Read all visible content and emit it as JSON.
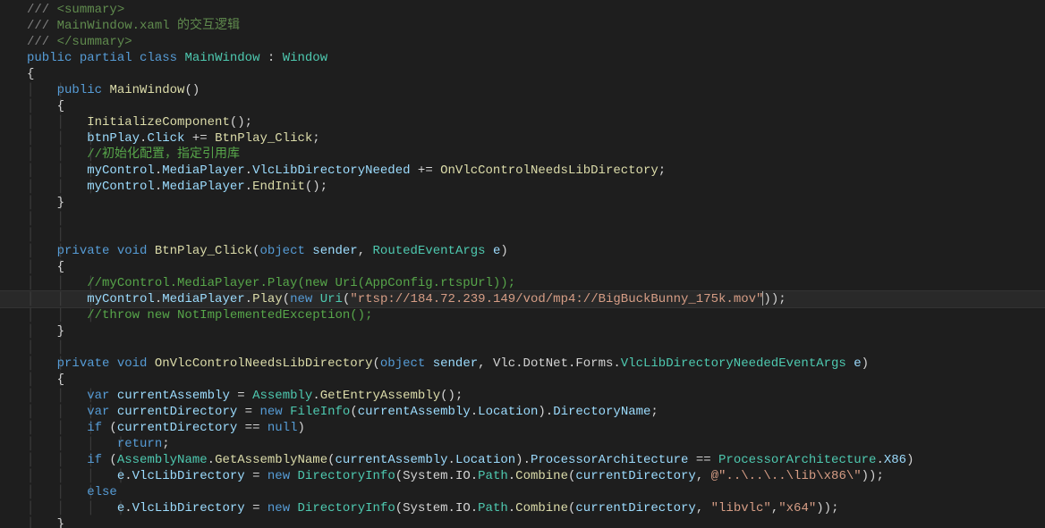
{
  "colors": {
    "background": "#1e1e1e",
    "comment": "#57a64a",
    "keyword": "#569cd6",
    "type": "#4ec9b0",
    "method": "#dcdcaa",
    "variable": "#9cdcfe",
    "string": "#d69d85",
    "default": "#d4d4d4",
    "gray": "#808080"
  },
  "code": {
    "lines": [
      {
        "indent": 0,
        "tokens": [
          [
            "c-gray",
            "///"
          ],
          [
            "c-xmlcomment",
            " <summary>"
          ]
        ]
      },
      {
        "indent": 0,
        "tokens": [
          [
            "c-gray",
            "///"
          ],
          [
            "c-xmlcomment",
            " MainWindow.xaml 的交互逻辑"
          ]
        ]
      },
      {
        "indent": 0,
        "tokens": [
          [
            "c-gray",
            "///"
          ],
          [
            "c-xmlcomment",
            " </summary>"
          ]
        ]
      },
      {
        "indent": 0,
        "tokens": [
          [
            "c-keyword",
            "public"
          ],
          [
            "c-punct",
            " "
          ],
          [
            "c-keyword",
            "partial"
          ],
          [
            "c-punct",
            " "
          ],
          [
            "c-keyword",
            "class"
          ],
          [
            "c-punct",
            " "
          ],
          [
            "c-type",
            "MainWindow"
          ],
          [
            "c-punct",
            " : "
          ],
          [
            "c-type",
            "Window"
          ]
        ]
      },
      {
        "indent": 0,
        "tokens": [
          [
            "c-punct",
            "{"
          ]
        ]
      },
      {
        "indent": 1,
        "tokens": [
          [
            "c-keyword",
            "public"
          ],
          [
            "c-punct",
            " "
          ],
          [
            "c-method",
            "MainWindow"
          ],
          [
            "c-punct",
            "()"
          ]
        ]
      },
      {
        "indent": 1,
        "tokens": [
          [
            "c-punct",
            "{"
          ]
        ]
      },
      {
        "indent": 2,
        "tokens": [
          [
            "c-method",
            "InitializeComponent"
          ],
          [
            "c-punct",
            "();"
          ]
        ]
      },
      {
        "indent": 2,
        "tokens": [
          [
            "c-var",
            "btnPlay"
          ],
          [
            "c-punct",
            "."
          ],
          [
            "c-var",
            "Click"
          ],
          [
            "c-punct",
            " += "
          ],
          [
            "c-method",
            "BtnPlay_Click"
          ],
          [
            "c-punct",
            ";"
          ]
        ]
      },
      {
        "indent": 2,
        "tokens": [
          [
            "c-comment",
            "//初始化配置，指定引用库"
          ]
        ]
      },
      {
        "indent": 2,
        "tokens": [
          [
            "c-var",
            "myControl"
          ],
          [
            "c-punct",
            "."
          ],
          [
            "c-var",
            "MediaPlayer"
          ],
          [
            "c-punct",
            "."
          ],
          [
            "c-var",
            "VlcLibDirectoryNeeded"
          ],
          [
            "c-punct",
            " += "
          ],
          [
            "c-method",
            "OnVlcControlNeedsLibDirectory"
          ],
          [
            "c-punct",
            ";"
          ]
        ]
      },
      {
        "indent": 2,
        "tokens": [
          [
            "c-var",
            "myControl"
          ],
          [
            "c-punct",
            "."
          ],
          [
            "c-var",
            "MediaPlayer"
          ],
          [
            "c-punct",
            "."
          ],
          [
            "c-method",
            "EndInit"
          ],
          [
            "c-punct",
            "();"
          ]
        ]
      },
      {
        "indent": 1,
        "tokens": [
          [
            "c-punct",
            "}"
          ]
        ]
      },
      {
        "indent": 0,
        "tokens": []
      },
      {
        "indent": 0,
        "tokens": []
      },
      {
        "indent": 1,
        "tokens": [
          [
            "c-keyword",
            "private"
          ],
          [
            "c-punct",
            " "
          ],
          [
            "c-keyword",
            "void"
          ],
          [
            "c-punct",
            " "
          ],
          [
            "c-method",
            "BtnPlay_Click"
          ],
          [
            "c-punct",
            "("
          ],
          [
            "c-keyword",
            "object"
          ],
          [
            "c-punct",
            " "
          ],
          [
            "c-var",
            "sender"
          ],
          [
            "c-punct",
            ", "
          ],
          [
            "c-type",
            "RoutedEventArgs"
          ],
          [
            "c-punct",
            " "
          ],
          [
            "c-var",
            "e"
          ],
          [
            "c-punct",
            ")"
          ]
        ]
      },
      {
        "indent": 1,
        "tokens": [
          [
            "c-punct",
            "{"
          ]
        ]
      },
      {
        "indent": 2,
        "tokens": [
          [
            "c-comment",
            "//myControl.MediaPlayer.Play(new Uri(AppConfig.rtspUrl));"
          ]
        ]
      },
      {
        "indent": 2,
        "hl": true,
        "tokens": [
          [
            "c-var",
            "myControl"
          ],
          [
            "c-punct",
            "."
          ],
          [
            "c-var",
            "MediaPlayer"
          ],
          [
            "c-punct",
            "."
          ],
          [
            "c-method",
            "Play"
          ],
          [
            "c-punct",
            "("
          ],
          [
            "c-keyword",
            "new"
          ],
          [
            "c-punct",
            " "
          ],
          [
            "c-type",
            "Uri"
          ],
          [
            "c-punct",
            "("
          ],
          [
            "c-string",
            "\"rtsp://184.72.239.149/vod/mp4://BigBuckBunny_175k.mov\""
          ],
          [
            "c-punct",
            "));"
          ]
        ],
        "caret": true
      },
      {
        "indent": 2,
        "tokens": [
          [
            "c-comment",
            "//throw new NotImplementedException();"
          ]
        ]
      },
      {
        "indent": 1,
        "tokens": [
          [
            "c-punct",
            "}"
          ]
        ]
      },
      {
        "indent": 0,
        "tokens": []
      },
      {
        "indent": 1,
        "tokens": [
          [
            "c-keyword",
            "private"
          ],
          [
            "c-punct",
            " "
          ],
          [
            "c-keyword",
            "void"
          ],
          [
            "c-punct",
            " "
          ],
          [
            "c-method",
            "OnVlcControlNeedsLibDirectory"
          ],
          [
            "c-punct",
            "("
          ],
          [
            "c-keyword",
            "object"
          ],
          [
            "c-punct",
            " "
          ],
          [
            "c-var",
            "sender"
          ],
          [
            "c-punct",
            ", "
          ],
          [
            "c-namespace",
            "Vlc.DotNet.Forms."
          ],
          [
            "c-type",
            "VlcLibDirectoryNeededEventArgs"
          ],
          [
            "c-punct",
            " "
          ],
          [
            "c-var",
            "e"
          ],
          [
            "c-punct",
            ")"
          ]
        ]
      },
      {
        "indent": 1,
        "tokens": [
          [
            "c-punct",
            "{"
          ]
        ]
      },
      {
        "indent": 2,
        "tokens": [
          [
            "c-keyword",
            "var"
          ],
          [
            "c-punct",
            " "
          ],
          [
            "c-var",
            "currentAssembly"
          ],
          [
            "c-punct",
            " = "
          ],
          [
            "c-type",
            "Assembly"
          ],
          [
            "c-punct",
            "."
          ],
          [
            "c-method",
            "GetEntryAssembly"
          ],
          [
            "c-punct",
            "();"
          ]
        ]
      },
      {
        "indent": 2,
        "tokens": [
          [
            "c-keyword",
            "var"
          ],
          [
            "c-punct",
            " "
          ],
          [
            "c-var",
            "currentDirectory"
          ],
          [
            "c-punct",
            " = "
          ],
          [
            "c-keyword",
            "new"
          ],
          [
            "c-punct",
            " "
          ],
          [
            "c-type",
            "FileInfo"
          ],
          [
            "c-punct",
            "("
          ],
          [
            "c-var",
            "currentAssembly"
          ],
          [
            "c-punct",
            "."
          ],
          [
            "c-var",
            "Location"
          ],
          [
            "c-punct",
            ")."
          ],
          [
            "c-var",
            "DirectoryName"
          ],
          [
            "c-punct",
            ";"
          ]
        ]
      },
      {
        "indent": 2,
        "tokens": [
          [
            "c-keyword",
            "if"
          ],
          [
            "c-punct",
            " ("
          ],
          [
            "c-var",
            "currentDirectory"
          ],
          [
            "c-punct",
            " == "
          ],
          [
            "c-keyword",
            "null"
          ],
          [
            "c-punct",
            ")"
          ]
        ]
      },
      {
        "indent": 3,
        "tokens": [
          [
            "c-keyword",
            "return"
          ],
          [
            "c-punct",
            ";"
          ]
        ]
      },
      {
        "indent": 2,
        "tokens": [
          [
            "c-keyword",
            "if"
          ],
          [
            "c-punct",
            " ("
          ],
          [
            "c-type",
            "AssemblyName"
          ],
          [
            "c-punct",
            "."
          ],
          [
            "c-method",
            "GetAssemblyName"
          ],
          [
            "c-punct",
            "("
          ],
          [
            "c-var",
            "currentAssembly"
          ],
          [
            "c-punct",
            "."
          ],
          [
            "c-var",
            "Location"
          ],
          [
            "c-punct",
            ")."
          ],
          [
            "c-var",
            "ProcessorArchitecture"
          ],
          [
            "c-punct",
            " == "
          ],
          [
            "c-type",
            "ProcessorArchitecture"
          ],
          [
            "c-punct",
            "."
          ],
          [
            "c-var",
            "X86"
          ],
          [
            "c-punct",
            ")"
          ]
        ]
      },
      {
        "indent": 3,
        "tokens": [
          [
            "c-var",
            "e"
          ],
          [
            "c-punct",
            "."
          ],
          [
            "c-var",
            "VlcLibDirectory"
          ],
          [
            "c-punct",
            " = "
          ],
          [
            "c-keyword",
            "new"
          ],
          [
            "c-punct",
            " "
          ],
          [
            "c-type",
            "DirectoryInfo"
          ],
          [
            "c-punct",
            "("
          ],
          [
            "c-namespace",
            "System.IO."
          ],
          [
            "c-type",
            "Path"
          ],
          [
            "c-punct",
            "."
          ],
          [
            "c-method",
            "Combine"
          ],
          [
            "c-punct",
            "("
          ],
          [
            "c-var",
            "currentDirectory"
          ],
          [
            "c-punct",
            ", "
          ],
          [
            "c-string",
            "@\"..\\..\\..\\lib\\x86\\\""
          ],
          [
            "c-punct",
            "));"
          ]
        ]
      },
      {
        "indent": 2,
        "tokens": [
          [
            "c-keyword",
            "else"
          ]
        ]
      },
      {
        "indent": 3,
        "tokens": [
          [
            "c-var",
            "e"
          ],
          [
            "c-punct",
            "."
          ],
          [
            "c-var",
            "VlcLibDirectory"
          ],
          [
            "c-punct",
            " = "
          ],
          [
            "c-keyword",
            "new"
          ],
          [
            "c-punct",
            " "
          ],
          [
            "c-type",
            "DirectoryInfo"
          ],
          [
            "c-punct",
            "("
          ],
          [
            "c-namespace",
            "System.IO."
          ],
          [
            "c-type",
            "Path"
          ],
          [
            "c-punct",
            "."
          ],
          [
            "c-method",
            "Combine"
          ],
          [
            "c-punct",
            "("
          ],
          [
            "c-var",
            "currentDirectory"
          ],
          [
            "c-punct",
            ", "
          ],
          [
            "c-string",
            "\"libvlc\""
          ],
          [
            "c-punct",
            ","
          ],
          [
            "c-string",
            "\"x64\""
          ],
          [
            "c-punct",
            "));"
          ]
        ]
      },
      {
        "indent": 1,
        "tokens": [
          [
            "c-punct",
            "}"
          ]
        ]
      }
    ]
  }
}
